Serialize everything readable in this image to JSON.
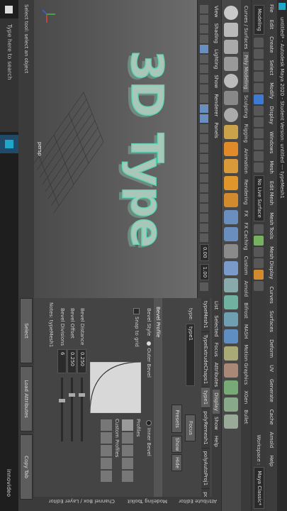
{
  "title": "untitled* - Autodesk Maya 2020 - Student Version: untitled --- typeMesh1",
  "menus": [
    "File",
    "Edit",
    "Create",
    "Select",
    "Modify",
    "Display",
    "Windows",
    "Mesh",
    "Edit Mesh",
    "Mesh Tools",
    "Mesh Display",
    "Curves",
    "Surfaces",
    "Deform",
    "UV",
    "Generate",
    "Cache",
    "Arnold",
    "Help"
  ],
  "status": {
    "mode": "Modeling",
    "no_live_surface": "No Live Surface",
    "workspace_label": "Workspace :",
    "workspace": "Maya Classic*"
  },
  "shelf_tabs": [
    "Curves / Surfaces",
    "Poly Modeling",
    "Sculpting",
    "Rigging",
    "Animation",
    "Rendering",
    "FX",
    "FX Caching",
    "Custom",
    "Arnold",
    "Bifrost",
    "MASH",
    "Motion Graphics",
    "XGen",
    "Bullet"
  ],
  "viewport": {
    "panel_menus": [
      "View",
      "Shading",
      "Lighting",
      "Show",
      "Renderer",
      "Panels"
    ],
    "near": "0.00",
    "far": "1.00",
    "camera": "persp",
    "type_text": "3D Type"
  },
  "right": {
    "top_tabs": [
      "List",
      "Selected",
      "Focus",
      "Attributes",
      "Display",
      "Show",
      "Help"
    ],
    "node_tabs": [
      "typeMesh1",
      "TypeExtrudeChaps1",
      "type1",
      "polyRemesh1",
      "polyAutoProj1",
      "po"
    ],
    "type_label": "type:",
    "type_value": "type1",
    "focus": "Focus",
    "presets": "Presets",
    "show": "Show",
    "hide": "Hide",
    "section": "Bevel Profile",
    "bevel_style_label": "Bevel Style",
    "bevel_outer": "Outer Bevel",
    "bevel_inner": "Inner Bevel",
    "profiles_label": "Profiles",
    "custom_profiles_label": "Custom Profiles",
    "snap_to_grid": "Snap to grid",
    "bevel_distance_label": "Bevel Distance",
    "bevel_distance": "0.250",
    "bevel_offset_label": "Bevel Offset",
    "bevel_offset": "0.250",
    "bevel_divisions_label": "Bevel Divisions",
    "bevel_divisions": "6",
    "notes": "Notes: typeMesh1",
    "select": "Select",
    "load_attributes": "Load Attributes",
    "copy_tab": "Copy Tab"
  },
  "side_tabs": [
    "Attribute Editor",
    "Modeling Toolkit",
    "Channel Box / Layer Editor"
  ],
  "taskbar": {
    "search": "Type here to search",
    "app": "innovideo"
  },
  "left_hint": "Select tool: select an object",
  "colors": {
    "accent": "#3e7ad1",
    "mesh": "#a9c7b8",
    "wire": "#5ed6b6"
  }
}
